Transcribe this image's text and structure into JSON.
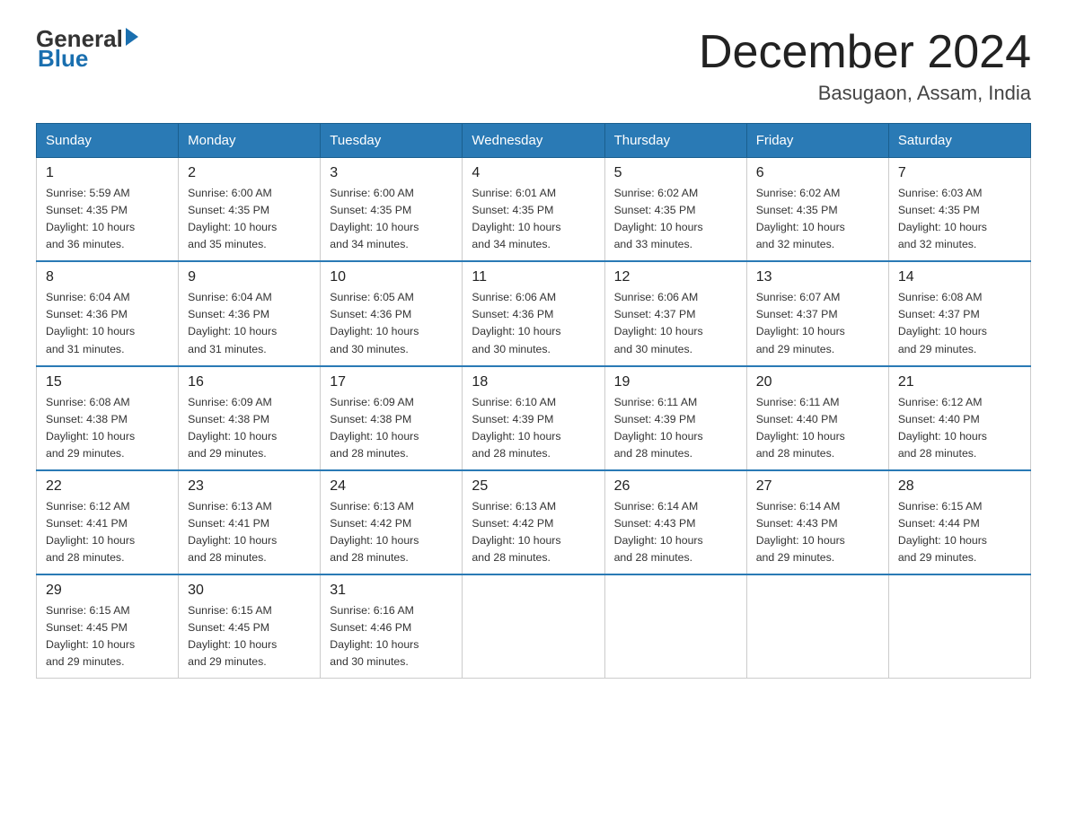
{
  "logo": {
    "general": "General",
    "blue": "Blue"
  },
  "title": "December 2024",
  "location": "Basugaon, Assam, India",
  "days_of_week": [
    "Sunday",
    "Monday",
    "Tuesday",
    "Wednesday",
    "Thursday",
    "Friday",
    "Saturday"
  ],
  "weeks": [
    [
      {
        "day": "1",
        "sunrise": "5:59 AM",
        "sunset": "4:35 PM",
        "daylight": "10 hours and 36 minutes."
      },
      {
        "day": "2",
        "sunrise": "6:00 AM",
        "sunset": "4:35 PM",
        "daylight": "10 hours and 35 minutes."
      },
      {
        "day": "3",
        "sunrise": "6:00 AM",
        "sunset": "4:35 PM",
        "daylight": "10 hours and 34 minutes."
      },
      {
        "day": "4",
        "sunrise": "6:01 AM",
        "sunset": "4:35 PM",
        "daylight": "10 hours and 34 minutes."
      },
      {
        "day": "5",
        "sunrise": "6:02 AM",
        "sunset": "4:35 PM",
        "daylight": "10 hours and 33 minutes."
      },
      {
        "day": "6",
        "sunrise": "6:02 AM",
        "sunset": "4:35 PM",
        "daylight": "10 hours and 32 minutes."
      },
      {
        "day": "7",
        "sunrise": "6:03 AM",
        "sunset": "4:35 PM",
        "daylight": "10 hours and 32 minutes."
      }
    ],
    [
      {
        "day": "8",
        "sunrise": "6:04 AM",
        "sunset": "4:36 PM",
        "daylight": "10 hours and 31 minutes."
      },
      {
        "day": "9",
        "sunrise": "6:04 AM",
        "sunset": "4:36 PM",
        "daylight": "10 hours and 31 minutes."
      },
      {
        "day": "10",
        "sunrise": "6:05 AM",
        "sunset": "4:36 PM",
        "daylight": "10 hours and 30 minutes."
      },
      {
        "day": "11",
        "sunrise": "6:06 AM",
        "sunset": "4:36 PM",
        "daylight": "10 hours and 30 minutes."
      },
      {
        "day": "12",
        "sunrise": "6:06 AM",
        "sunset": "4:37 PM",
        "daylight": "10 hours and 30 minutes."
      },
      {
        "day": "13",
        "sunrise": "6:07 AM",
        "sunset": "4:37 PM",
        "daylight": "10 hours and 29 minutes."
      },
      {
        "day": "14",
        "sunrise": "6:08 AM",
        "sunset": "4:37 PM",
        "daylight": "10 hours and 29 minutes."
      }
    ],
    [
      {
        "day": "15",
        "sunrise": "6:08 AM",
        "sunset": "4:38 PM",
        "daylight": "10 hours and 29 minutes."
      },
      {
        "day": "16",
        "sunrise": "6:09 AM",
        "sunset": "4:38 PM",
        "daylight": "10 hours and 29 minutes."
      },
      {
        "day": "17",
        "sunrise": "6:09 AM",
        "sunset": "4:38 PM",
        "daylight": "10 hours and 28 minutes."
      },
      {
        "day": "18",
        "sunrise": "6:10 AM",
        "sunset": "4:39 PM",
        "daylight": "10 hours and 28 minutes."
      },
      {
        "day": "19",
        "sunrise": "6:11 AM",
        "sunset": "4:39 PM",
        "daylight": "10 hours and 28 minutes."
      },
      {
        "day": "20",
        "sunrise": "6:11 AM",
        "sunset": "4:40 PM",
        "daylight": "10 hours and 28 minutes."
      },
      {
        "day": "21",
        "sunrise": "6:12 AM",
        "sunset": "4:40 PM",
        "daylight": "10 hours and 28 minutes."
      }
    ],
    [
      {
        "day": "22",
        "sunrise": "6:12 AM",
        "sunset": "4:41 PM",
        "daylight": "10 hours and 28 minutes."
      },
      {
        "day": "23",
        "sunrise": "6:13 AM",
        "sunset": "4:41 PM",
        "daylight": "10 hours and 28 minutes."
      },
      {
        "day": "24",
        "sunrise": "6:13 AM",
        "sunset": "4:42 PM",
        "daylight": "10 hours and 28 minutes."
      },
      {
        "day": "25",
        "sunrise": "6:13 AM",
        "sunset": "4:42 PM",
        "daylight": "10 hours and 28 minutes."
      },
      {
        "day": "26",
        "sunrise": "6:14 AM",
        "sunset": "4:43 PM",
        "daylight": "10 hours and 28 minutes."
      },
      {
        "day": "27",
        "sunrise": "6:14 AM",
        "sunset": "4:43 PM",
        "daylight": "10 hours and 29 minutes."
      },
      {
        "day": "28",
        "sunrise": "6:15 AM",
        "sunset": "4:44 PM",
        "daylight": "10 hours and 29 minutes."
      }
    ],
    [
      {
        "day": "29",
        "sunrise": "6:15 AM",
        "sunset": "4:45 PM",
        "daylight": "10 hours and 29 minutes."
      },
      {
        "day": "30",
        "sunrise": "6:15 AM",
        "sunset": "4:45 PM",
        "daylight": "10 hours and 29 minutes."
      },
      {
        "day": "31",
        "sunrise": "6:16 AM",
        "sunset": "4:46 PM",
        "daylight": "10 hours and 30 minutes."
      },
      null,
      null,
      null,
      null
    ]
  ],
  "labels": {
    "sunrise": "Sunrise:",
    "sunset": "Sunset:",
    "daylight": "Daylight:"
  }
}
